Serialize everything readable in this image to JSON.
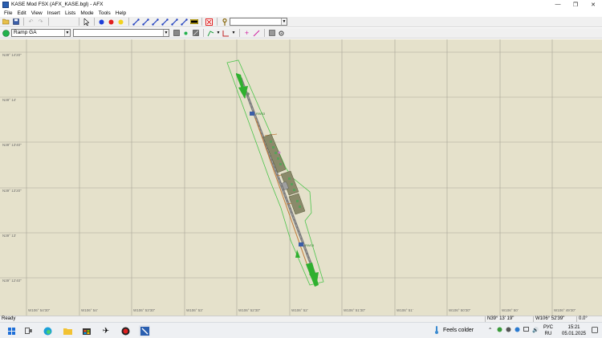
{
  "window": {
    "title": "KASE Mod FSX (AFX_KASE.bgl) - AFX",
    "minimize_glyph": "—",
    "maximize_glyph": "❐",
    "close_glyph": "✕"
  },
  "menu": [
    "File",
    "Edit",
    "View",
    "Insert",
    "Lists",
    "Mode",
    "Tools",
    "Help"
  ],
  "toolbar1": {
    "icons": [
      "open-icon",
      "save-icon",
      "undo-icon",
      "redo-icon",
      "pointer-icon",
      "blue-point-icon",
      "red-point-icon",
      "yellow-point-icon",
      "link-tool-icon",
      "delete-icon",
      "key-icon"
    ],
    "search_combo_value": ""
  },
  "toolbar2": {
    "parking_type_value": "Ramp GA",
    "secondary_combo_value": "",
    "status_color": "#22b14c"
  },
  "map": {
    "background": "#e5e1cb",
    "grid_color": "#a7a496",
    "lat_labels": [
      "N39° 14'20\"",
      "N39° 14'",
      "N39° 13'40\"",
      "N39° 13'20\"",
      "N39° 13'",
      "N39° 12'40\""
    ],
    "lon_labels": [
      "W106° 54'30\"",
      "W106° 54'",
      "W106° 53'30\"",
      "W106° 53'",
      "W106° 52'30\"",
      "W106° 52'",
      "W106° 51'30\"",
      "W106° 51'",
      "W106° 50'30\"",
      "W106° 50'",
      "W106° 49'30\""
    ],
    "runway_label_north": "RW33",
    "runway_label_south": "RW15"
  },
  "status": {
    "text": "Ready",
    "latitude": "N39° 13' 19\"",
    "longitude": "W106° 52'39\"",
    "heading": "0.0°"
  },
  "taskbar": {
    "weather": "Feels colder",
    "lang_top": "РУС",
    "lang_bottom": "RU",
    "time": "15:21",
    "date": "05.01.2025"
  }
}
